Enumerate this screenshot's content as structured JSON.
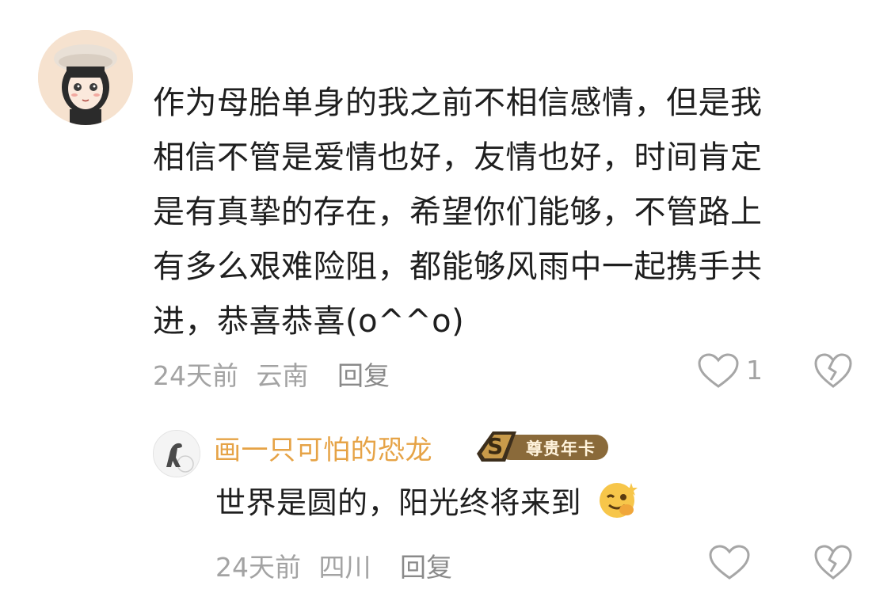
{
  "comment": {
    "text": "作为母胎单身的我之前不相信感情，但是我相信不管是爱情也好，友情也好，时间肯定是有真挚的存在，希望你们能够，不管路上有多么艰难险阻，都能够风雨中一起携手共进，恭喜恭喜(o^^o)",
    "lines": [
      "作为母胎单身的我之前不相信感情，但是我",
      "相信不管是爱情也好，友情也好，时间肯定",
      "是有真挚的存在，希望你们能够，不管路上",
      "有多么艰难险阻，都能够风雨中一起携手共",
      "进，恭喜恭喜(o^^o)"
    ],
    "time": "24天前",
    "location": "云南",
    "reply_label": "回复",
    "like_count": "1",
    "like_icon": "heart-outline-icon",
    "dislike_icon": "broken-heart-icon"
  },
  "reply": {
    "username": "画一只可怕的恐龙",
    "badge_label": "尊贵年卡",
    "badge_letter": "S",
    "text": "世界是圆的，阳光终将来到",
    "emoji_icon": "wink-emoji-icon",
    "time": "24天前",
    "location": "四川",
    "reply_label": "回复",
    "like_icon": "heart-outline-icon",
    "dislike_icon": "broken-heart-icon"
  },
  "colors": {
    "username": "#e6a346",
    "meta": "#a3a3a3",
    "text": "#1f1f1f"
  }
}
